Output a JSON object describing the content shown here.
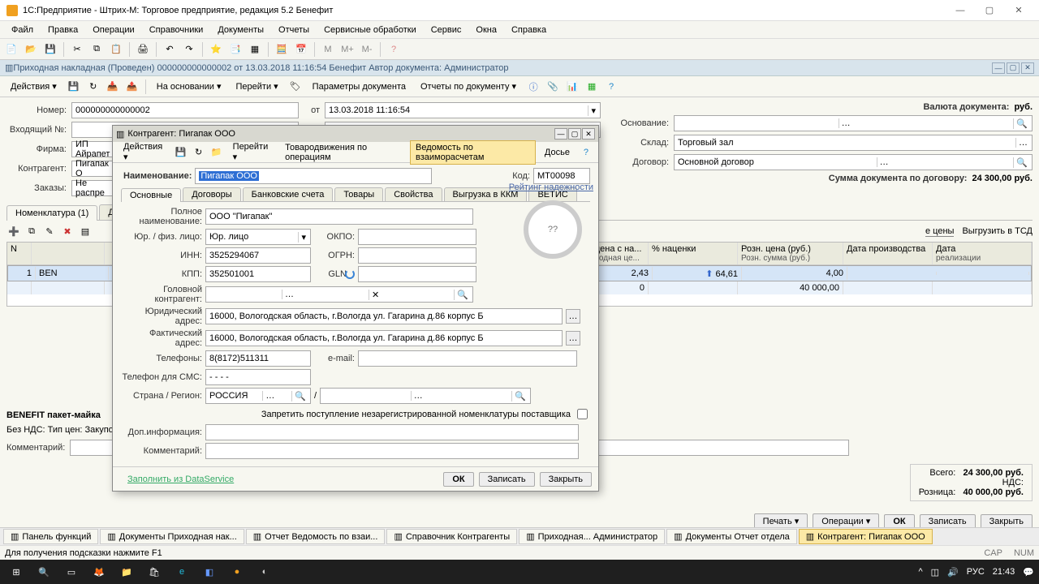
{
  "app_title": "1С:Предприятие - Штрих-М: Торговое предприятие, редакция 5.2 Бенефит",
  "menu": [
    "Файл",
    "Правка",
    "Операции",
    "Справочники",
    "Документы",
    "Отчеты",
    "Сервисные обработки",
    "Сервис",
    "Окна",
    "Справка"
  ],
  "doc_titlebar": "Приходная накладная (Проведен)   000000000000002 от 13.03.2018 11:16:54 Бенефит   Автор документа: Администратор",
  "doc_toolbar": {
    "actions": "Действия ▾",
    "on_basis": "На основании ▾",
    "go": "Перейти ▾",
    "params": "Параметры документа",
    "reports": "Отчеты по документу ▾"
  },
  "header": {
    "number_lbl": "Номер:",
    "number": "000000000000002",
    "date_lbl": "от",
    "date": "13.03.2018 11:16:54",
    "incoming_lbl": "Входящий №:",
    "incoming": "",
    "firm_lbl": "Фирма:",
    "firm": "ИП Айрапет",
    "contragent_lbl": "Контрагент:",
    "contragent": "Пигапак О",
    "orders_lbl": "Заказы:",
    "orders": "Не распре",
    "currency_lbl": "Валюта документа:",
    "currency": "руб.",
    "basis_lbl": "Основание:",
    "basis": "",
    "store_lbl": "Склад:",
    "store": "Торговый зал",
    "contract_lbl": "Договор:",
    "contract": "Основной договор",
    "sum_lbl": "Сумма документа по договору:",
    "sum": "24 300,00 руб."
  },
  "tabs": [
    "Номенклатура (1)"
  ],
  "subtabs": {
    "prices": "е цены",
    "upload": "Выгрузить в ТСД"
  },
  "grid": {
    "cols": [
      "N",
      "",
      "",
      "цена с на...",
      "% наценки",
      "Розн. цена (руб.)",
      "Дата производства",
      "Дата"
    ],
    "subcols": [
      "",
      "",
      "",
      "ходная це...",
      "",
      "Розн. сумма (руб.)",
      "",
      "реализации"
    ],
    "rows": [
      [
        "1",
        "BEN",
        "",
        "2,43",
        "64,61",
        "4,00",
        "",
        ""
      ],
      [
        "",
        "",
        "",
        "0",
        "",
        "40 000,00",
        "",
        ""
      ]
    ]
  },
  "footer": {
    "benefit": "BENEFIT пакет-майка",
    "vat": "Без НДС: Тип цен: Закупочный тип цен",
    "comment_lbl": "Комментарий:",
    "totals": {
      "vsego_lbl": "Всего:",
      "vsego": "24 300,00 руб.",
      "nds_lbl": "НДС:",
      "nds": "",
      "retail_lbl": "Розница:",
      "retail": "40 000,00 руб."
    },
    "buttons": {
      "print": "Печать ▾",
      "ops": "Операции ▾",
      "ok": "ОК",
      "save": "Записать",
      "close": "Закрыть"
    }
  },
  "popup": {
    "title": "Контрагент: Пигапак ООО",
    "tb": {
      "actions": "Действия ▾",
      "go": "Перейти ▾",
      "tov": "Товародвижения по операциям",
      "ved": "Ведомость по взаиморасчетам",
      "dossier": "Досье"
    },
    "name_lbl": "Наименование:",
    "name": "Пигапак ООО",
    "code_lbl": "Код:",
    "code": "МТ00098",
    "tabs": [
      "Основные",
      "Договоры",
      "Банковские счета",
      "Товары",
      "Свойства",
      "Выгрузка в ККМ",
      "ВЕТИС"
    ],
    "fullname_lbl": "Полное наименование:",
    "fullname": "ООО \"Пигапак\"",
    "type_lbl": "Юр. / физ. лицо:",
    "type": "Юр. лицо",
    "okpo_lbl": "ОКПО:",
    "okpo": "",
    "inn_lbl": "ИНН:",
    "inn": "3525294067",
    "ogrn_lbl": "ОГРН:",
    "ogrn": "",
    "kpp_lbl": "КПП:",
    "kpp": "352501001",
    "gln_lbl": "GLN",
    "gln": "",
    "head_lbl": "Головной контрагент:",
    "head": "",
    "addr1_lbl": "Юридический адрес:",
    "addr1": "16000, Вологодская область, г.Вологда ул. Гагарина д.86 корпус Б",
    "addr2_lbl": "Фактический адрес:",
    "addr2": "16000, Вологодская область, г.Вологда ул. Гагарина д.86 корпус Б",
    "phone_lbl": "Телефоны:",
    "phone": "8(8172)511311",
    "email_lbl": "e-mail:",
    "email": "",
    "sms_lbl": "Телефон для СМС:",
    "sms": "- - - -",
    "country_lbl": "Страна / Регион:",
    "country": "РОССИЯ",
    "region_sep": "/",
    "forbid": "Запретить поступление незарегистрированной номенклатуры поставщика",
    "extra_lbl": "Доп.информация:",
    "extra": "",
    "comment_lbl": "Комментарий:",
    "comment": "",
    "rating_lbl": "Рейтинг надежности",
    "rating": "??",
    "footer": {
      "ds": "Заполнить из DataService",
      "ok": "ОК",
      "save": "Записать",
      "close": "Закрыть"
    }
  },
  "window_tabs": [
    "Панель функций",
    "Документы Приходная нак...",
    "Отчет Ведомость по взаи...",
    "Справочник Контрагенты",
    "Приходная... Администратор",
    "Документы Отчет отдела",
    "Контрагент: Пигапак ООО"
  ],
  "status_hint": "Для получения подсказки нажмите F1",
  "status_right": [
    "CAP",
    "NUM"
  ],
  "tray": {
    "lang": "РУС",
    "time": "21:43"
  }
}
